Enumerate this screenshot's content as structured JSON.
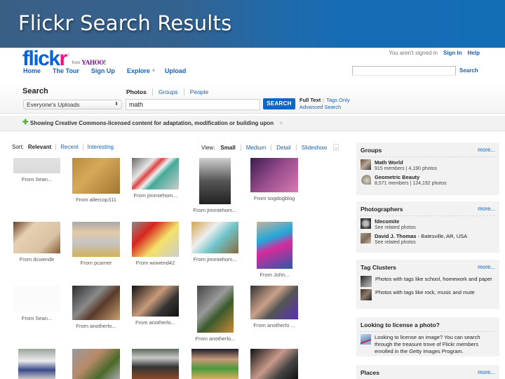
{
  "slide": {
    "title": "Flickr Search Results"
  },
  "brand": {
    "logo_flick": "flick",
    "logo_r": "r",
    "reg_mark": "®",
    "from_text": "from",
    "yahoo_text": "YAHOO!",
    "colors": {
      "flickr_blue": "#0063dc",
      "flickr_pink": "#ff0084",
      "link_blue": "#1a5fb4",
      "search_button": "#0f66c9",
      "cc_plus": "#4caf27"
    }
  },
  "top_nav": {
    "items": [
      "Home",
      "The Tour",
      "Sign Up",
      "Explore",
      "Upload"
    ],
    "explore_caret": "▾"
  },
  "account": {
    "status": "You aren't signed in",
    "sign_in": "Sign In",
    "help": "Help"
  },
  "header_search": {
    "value": "",
    "button": "Search"
  },
  "search": {
    "heading": "Search",
    "tabs": [
      {
        "label": "Photos",
        "active": true
      },
      {
        "label": "Groups",
        "active": false
      },
      {
        "label": "People",
        "active": false
      }
    ],
    "scope": "Everyone's Uploads",
    "query": "math",
    "button": "SEARCH",
    "full_text": "Full Text",
    "tags_only": "Tags Only",
    "advanced": "Advanced Search"
  },
  "cc_banner": {
    "text": "Showing Creative Commons-licensed content for adaptation, modification or building upon",
    "close": "×"
  },
  "sort": {
    "label": "Sort:",
    "options": [
      "Relevant",
      "Recent",
      "Interesting"
    ],
    "selected": "Relevant"
  },
  "view": {
    "label": "View:",
    "options": [
      "Small",
      "Medium",
      "Detail",
      "Slideshow"
    ],
    "selected": "Small"
  },
  "photos": [
    {
      "caption": "From Sean..."
    },
    {
      "caption": "From allercop311"
    },
    {
      "caption": "From jimmiehom..."
    },
    {
      "caption": "From jimmiehom..."
    },
    {
      "caption": "From sogdogblog"
    },
    {
      "caption": "From dcviende"
    },
    {
      "caption": "From pcarner"
    },
    {
      "caption": "From wowend42"
    },
    {
      "caption": "From jimmiehom..."
    },
    {
      "caption": "From John..."
    },
    {
      "caption": "From Sean..."
    },
    {
      "caption": "From anotherlo..."
    },
    {
      "caption": "From anotherlo..."
    },
    {
      "caption": "From anotherlo..."
    },
    {
      "caption": "From anotherlo ..."
    },
    {
      "caption": ""
    },
    {
      "caption": ""
    },
    {
      "caption": ""
    },
    {
      "caption": ""
    },
    {
      "caption": ""
    }
  ],
  "sidebar": {
    "more": "more...",
    "groups": {
      "title": "Groups",
      "items": [
        {
          "name": "Math World",
          "stats": "915 members | 4,190 photos"
        },
        {
          "name": "Geometric Beauty",
          "stats": "8,571 members | 124,192 photos"
        }
      ]
    },
    "photographers": {
      "title": "Photographers",
      "items": [
        {
          "name": "fdecomite",
          "location": "",
          "sub": "See related photos"
        },
        {
          "name": "David J. Thomas",
          "location": " - Batesville, AR, USA",
          "sub": "See related photos"
        }
      ]
    },
    "tag_clusters": {
      "title": "Tag Clusters",
      "items": [
        {
          "text": "Photos with tags like school, homework and paper"
        },
        {
          "text": "Photos with tags like rock, music and mute"
        }
      ]
    },
    "license": {
      "title": "Looking to license a photo?",
      "text": "Looking to license an image? You can search through the treasure trove of Flickr members enrolled in the Getty Images Program."
    },
    "places": {
      "title": "Places"
    }
  }
}
